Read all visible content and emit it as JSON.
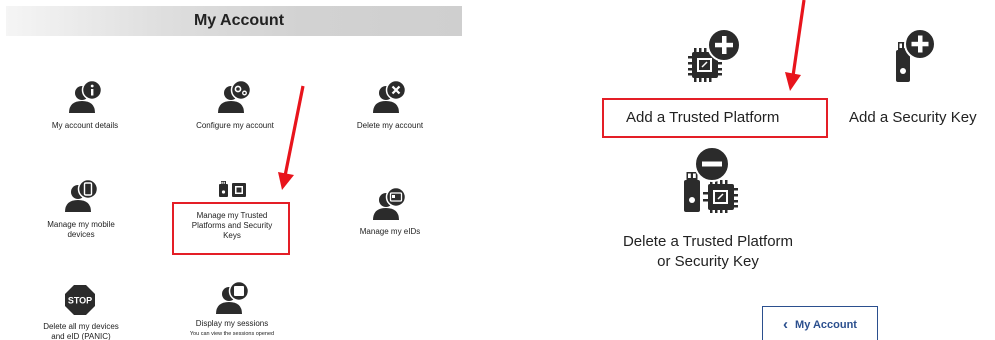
{
  "left": {
    "title": "My Account",
    "tiles": [
      {
        "label": "My account details",
        "icon": "user-info-icon"
      },
      {
        "label": "Configure my account",
        "icon": "user-gear-icon"
      },
      {
        "label": "Delete my account",
        "icon": "user-delete-icon"
      },
      {
        "label_lines": [
          "Manage my mobile",
          "devices"
        ],
        "icon": "user-mobile-icon"
      },
      {
        "label_lines": [
          "Manage my Trusted",
          "Platforms and Security",
          "Keys"
        ],
        "icon": "chip-key-icon"
      },
      {
        "label": "Manage my eIDs",
        "icon": "user-card-icon"
      },
      {
        "label_lines": [
          "Delete all my devices",
          "and eID (PANIC)"
        ],
        "icon": "stop-icon",
        "icon_text": "STOP"
      },
      {
        "label": "Display my sessions",
        "sub": "You can view the sessions opened",
        "icon": "user-session-icon"
      }
    ]
  },
  "right": {
    "add_platform": "Add a Trusted Platform",
    "add_key": "Add a Security Key",
    "delete_lines": [
      "Delete a Trusted Platform",
      "or Security Key"
    ],
    "back_label": "My Account",
    "back_chevron": "‹"
  },
  "colors": {
    "highlight": "#e41e26",
    "arrow": "#e8141c",
    "icon_dark": "#2b2b2b",
    "button_blue": "#2b4f8e"
  }
}
